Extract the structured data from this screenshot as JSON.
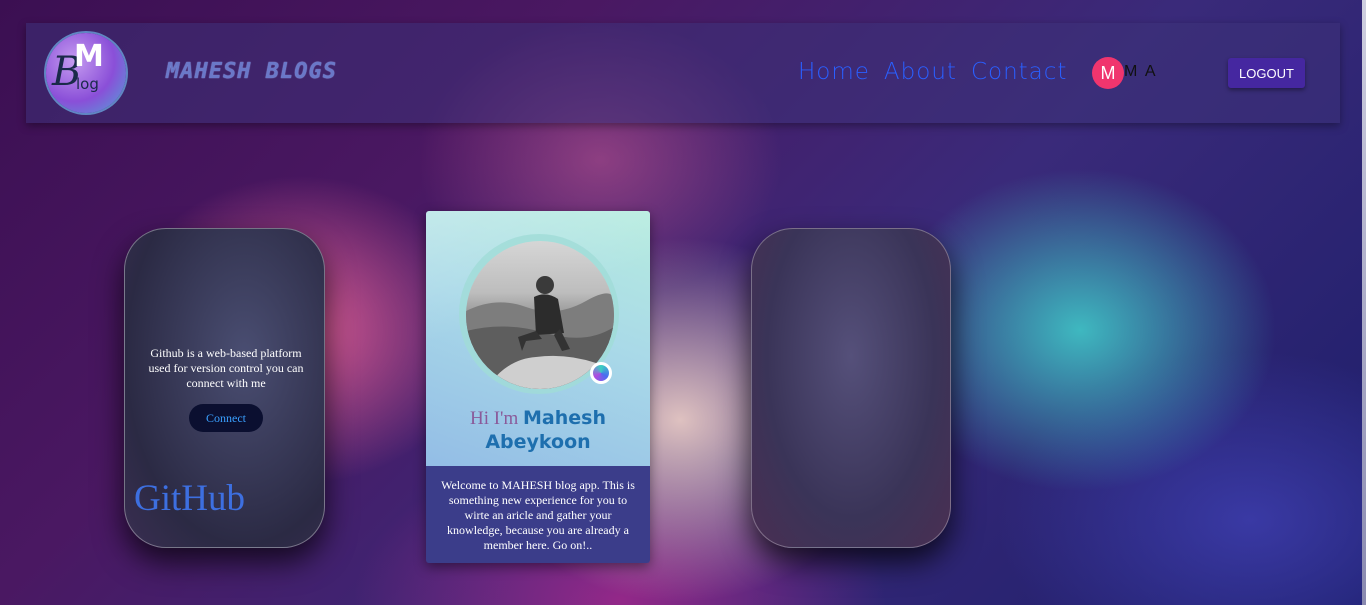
{
  "header": {
    "logo_text": "BMblog",
    "brand": "MAHESH BLOGS",
    "nav": [
      {
        "label": "Home"
      },
      {
        "label": "About"
      },
      {
        "label": "Contact"
      }
    ],
    "avatar_letter": "M",
    "user_initials": "M A",
    "logout_label": "LOGOUT"
  },
  "github_card": {
    "description": "Github is a web-based platform used for version control you can connect with me",
    "connect_label": "Connect",
    "title": "GitHub"
  },
  "profile_card": {
    "greeting_prefix": "Hi I'm",
    "first_name": "Mahesh",
    "last_name": "Abeykoon",
    "welcome_text": "Welcome to MAHESH blog app. This is something new experience for you to wirte an aricle and gather your knowledge, because you are already a member here. Go on!.."
  },
  "colors": {
    "nav_link": "#2a5fff",
    "avatar_bg": "#f0356e",
    "logout_bg": "#4527a0",
    "profile_bottom_bg": "#3b3d8a",
    "github_title": "#3d6fe0"
  }
}
